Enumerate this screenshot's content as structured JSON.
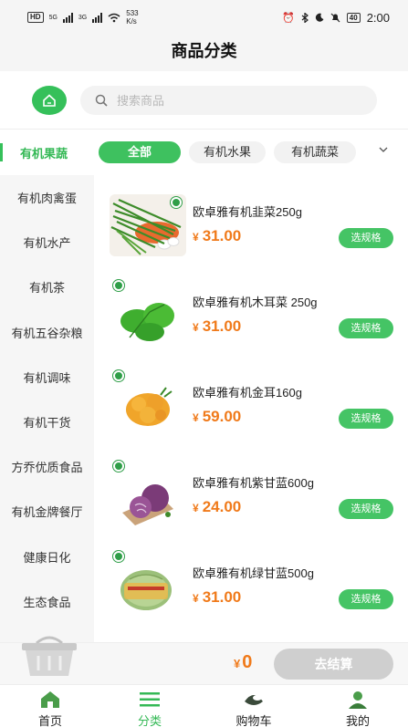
{
  "status_bar": {
    "hd_badge": "HD",
    "net1": "5G",
    "net2": "3G",
    "speed_value": "533",
    "speed_unit": "K/s",
    "battery": "40",
    "time": "2:00"
  },
  "title": "商品分类",
  "search": {
    "placeholder": "搜索商品"
  },
  "active_category": "有机果蔬",
  "filter_pills": [
    "全部",
    "有机水果",
    "有机蔬菜"
  ],
  "sidebar": {
    "items": [
      {
        "label": "有机肉禽蛋"
      },
      {
        "label": "有机水产"
      },
      {
        "label": "有机茶"
      },
      {
        "label": "有机五谷杂粮"
      },
      {
        "label": "有机调味"
      },
      {
        "label": "有机干货"
      },
      {
        "label": "方乔优质食品"
      },
      {
        "label": "有机金牌餐厅"
      },
      {
        "label": "健康日化"
      },
      {
        "label": "生态食品"
      }
    ]
  },
  "products": [
    {
      "name": "欧卓雅有机韭菜250g",
      "currency": "¥",
      "price": "31.00",
      "spec_label": "选规格",
      "image": "chives"
    },
    {
      "name": "欧卓雅有机木耳菜 250g",
      "currency": "¥",
      "price": "31.00",
      "spec_label": "选规格",
      "image": "malabar-spinach"
    },
    {
      "name": "欧卓雅有机金耳160g",
      "currency": "¥",
      "price": "59.00",
      "spec_label": "选规格",
      "image": "golden-fungus"
    },
    {
      "name": "欧卓雅有机紫甘蓝600g",
      "currency": "¥",
      "price": "24.00",
      "spec_label": "选规格",
      "image": "purple-cabbage"
    },
    {
      "name": "欧卓雅有机绿甘蓝500g",
      "currency": "¥",
      "price": "31.00",
      "spec_label": "选规格",
      "image": "green-cabbage"
    }
  ],
  "cart": {
    "currency": "¥",
    "total": "0",
    "checkout_label": "去结算"
  },
  "tabs": [
    {
      "label": "首页",
      "icon": "home-icon"
    },
    {
      "label": "分类",
      "icon": "list-icon"
    },
    {
      "label": "购物车",
      "icon": "cart-icon"
    },
    {
      "label": "我的",
      "icon": "user-icon"
    }
  ],
  "colors": {
    "accent": "#35C05A",
    "price": "#F07A1A",
    "checkout_disabled": "#CFCFCF"
  }
}
